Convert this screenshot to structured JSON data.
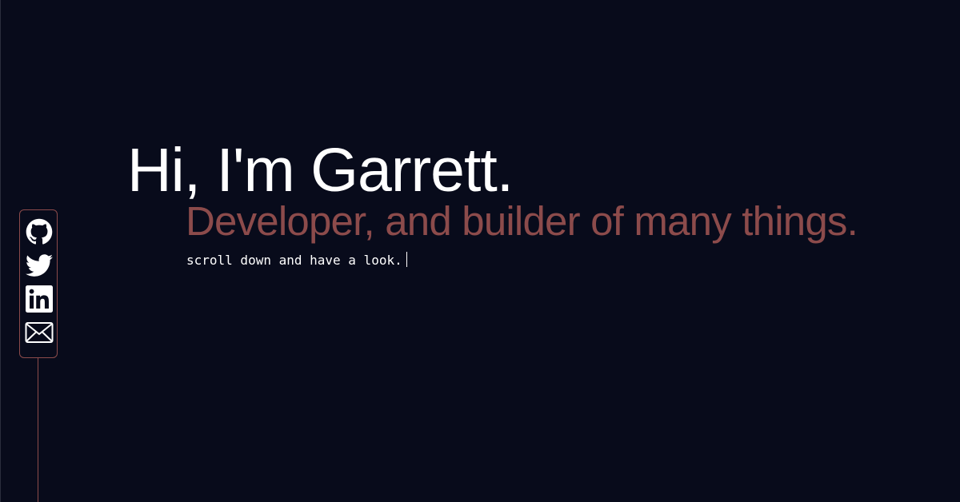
{
  "theme": {
    "background": "#080b1b",
    "text": "#ffffff",
    "accent": "#8c4b4b",
    "edge": "#2a2d3c"
  },
  "hero": {
    "title": "Hi, I'm Garrett.",
    "subtitle": "Developer, and builder of many things.",
    "tagline": "scroll down and have a look."
  },
  "social": {
    "links": [
      {
        "icon": "github-icon"
      },
      {
        "icon": "twitter-icon"
      },
      {
        "icon": "linkedin-icon"
      },
      {
        "icon": "email-icon"
      }
    ]
  }
}
